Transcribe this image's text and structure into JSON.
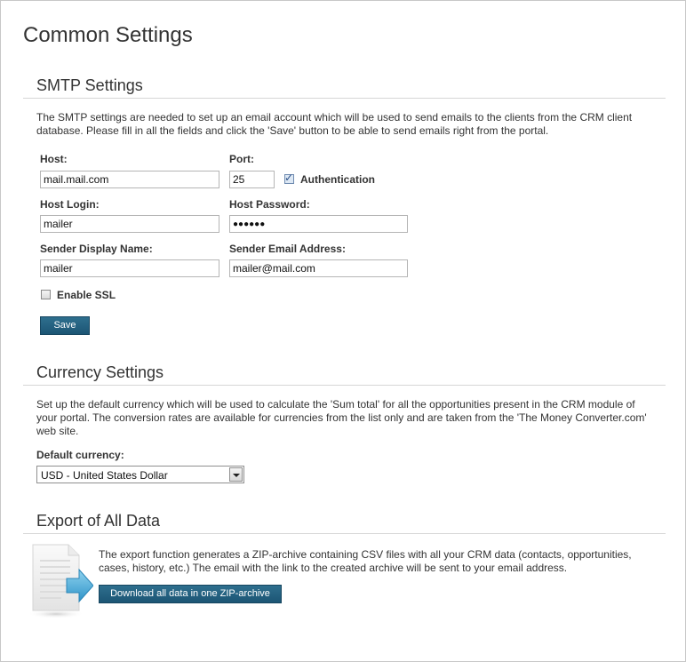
{
  "page": {
    "title": "Common Settings"
  },
  "smtp": {
    "title": "SMTP Settings",
    "description": "The SMTP settings are needed to set up an email account which will be used to send emails to the clients from the CRM client database. Please fill in all the fields and click the 'Save' button to be able to send emails right from the portal.",
    "host_label": "Host:",
    "host_value": "mail.mail.com",
    "port_label": "Port:",
    "port_value": "25",
    "auth_label": "Authentication",
    "auth_checked": true,
    "login_label": "Host Login:",
    "login_value": "mailer",
    "password_label": "Host Password:",
    "password_value": "●●●●●●",
    "sender_name_label": "Sender Display Name:",
    "sender_name_value": "mailer",
    "sender_email_label": "Sender Email Address:",
    "sender_email_value": "mailer@mail.com",
    "ssl_label": "Enable SSL",
    "ssl_checked": false,
    "save_label": "Save"
  },
  "currency": {
    "title": "Currency Settings",
    "description": "Set up the default currency which will be used to calculate the 'Sum total' for all the opportunities present in the CRM module of your portal. The conversion rates are available for currencies from the list only and are taken from the 'The Money Converter.com' web site.",
    "default_label": "Default currency:",
    "default_value": "USD - United States Dollar"
  },
  "export": {
    "title": "Export of All Data",
    "description": "The export function generates a ZIP-archive containing CSV files with all your CRM data (contacts, opportunities, cases, history, etc.) The email with the link to the created archive will be sent to your email address.",
    "download_label": "Download all data in one ZIP-archive",
    "icon": "document-export-icon"
  }
}
